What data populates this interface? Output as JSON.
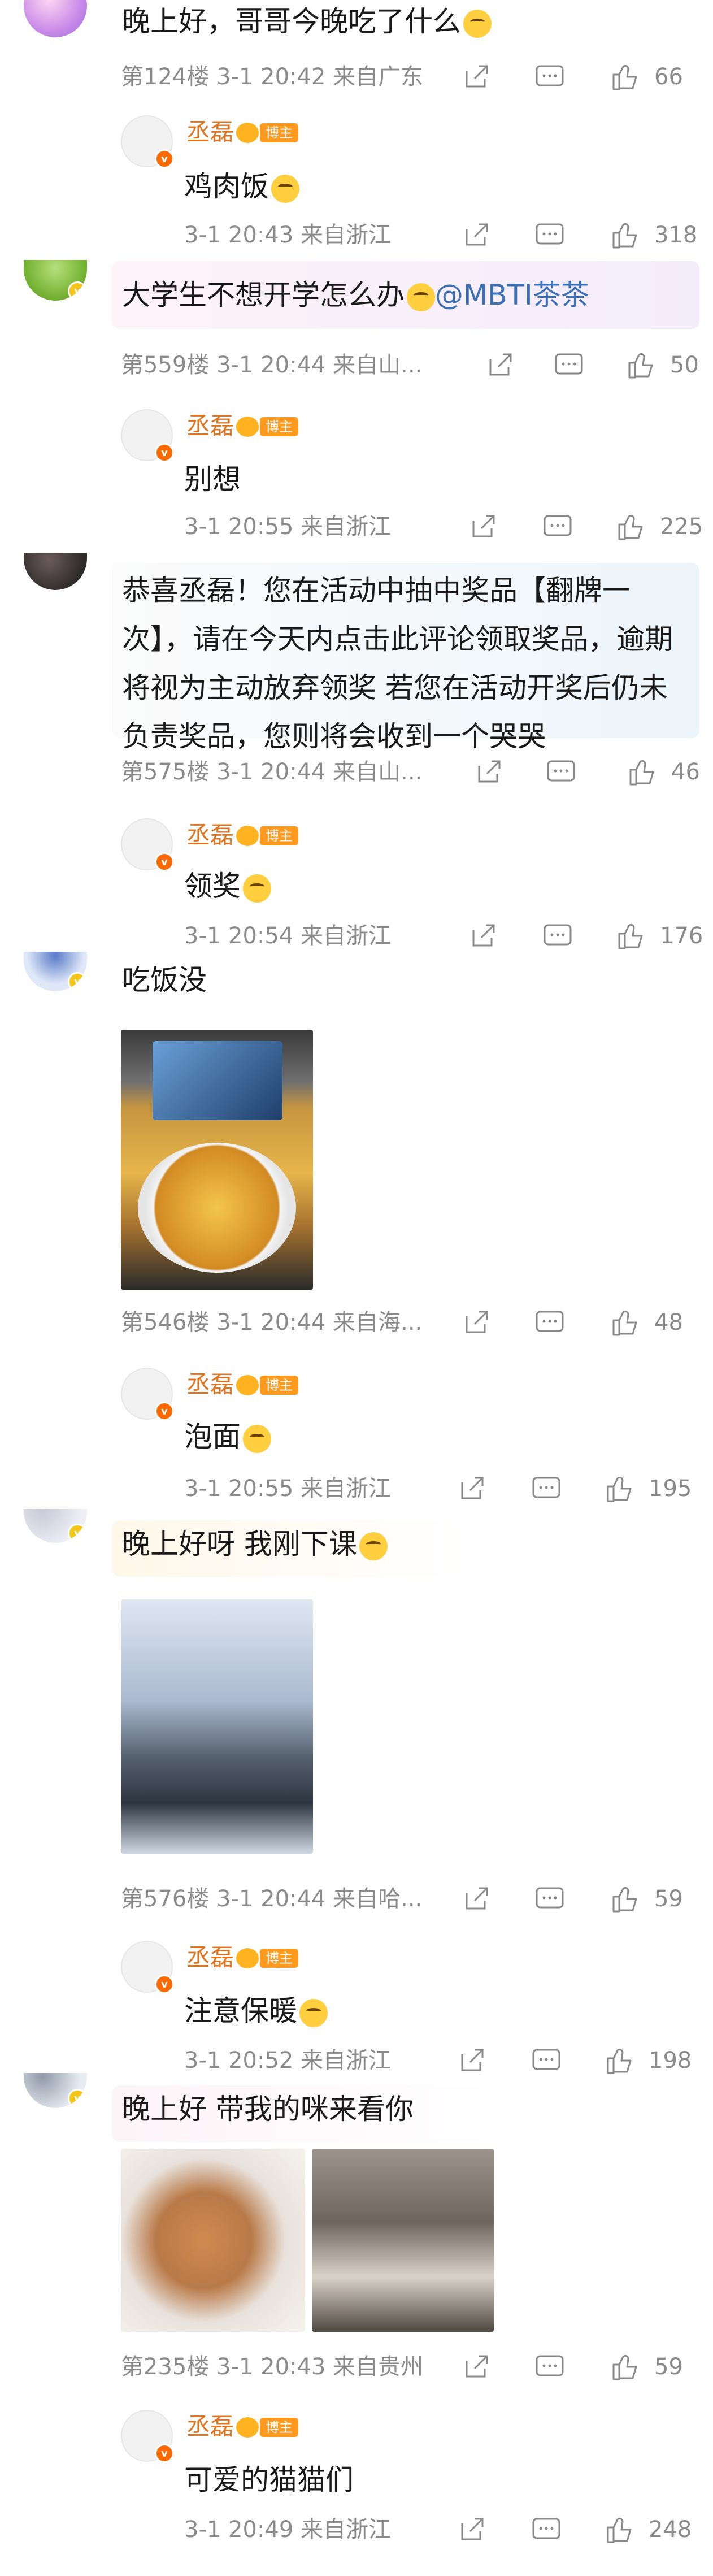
{
  "author": {
    "name": "丞磊",
    "badge": "博主"
  },
  "comments": [
    {
      "text": "晚上好，哥哥今晚吃了什么",
      "floor": "第124楼",
      "time": "3-1 20:42",
      "location": "来自广东",
      "likes": "66",
      "reply": {
        "text": "鸡肉饭",
        "time": "3-1 20:43",
        "location": "来自浙江",
        "likes": "318"
      }
    },
    {
      "text": "大学生不想开学怎么办",
      "mention": "@MBTI茶茶",
      "floor": "第559楼",
      "time": "3-1 20:44",
      "location": "来自山...",
      "likes": "50",
      "reply": {
        "text": "别想",
        "time": "3-1 20:55",
        "location": "来自浙江",
        "likes": "225"
      }
    },
    {
      "text": "恭喜丞磊！您在活动中抽中奖品【翻牌一次】，请在今天内点击此评论领取奖品，逾期将视为主动放弃领奖 若您在活动开奖后仍未负责奖品，您则将会收到一个哭哭",
      "floor": "第575楼",
      "time": "3-1 20:44",
      "location": "来自山...",
      "likes": "46",
      "reply": {
        "text": "领奖",
        "time": "3-1 20:54",
        "location": "来自浙江",
        "likes": "176"
      }
    },
    {
      "text": "吃饭没",
      "floor": "第546楼",
      "time": "3-1 20:44",
      "location": "来自海...",
      "likes": "48",
      "reply": {
        "text": "泡面",
        "time": "3-1 20:55",
        "location": "来自浙江",
        "likes": "195"
      }
    },
    {
      "text": "晚上好呀 我刚下课",
      "floor": "第576楼",
      "time": "3-1 20:44",
      "location": "来自哈...",
      "likes": "59",
      "reply": {
        "text": "注意保暖",
        "time": "3-1 20:52",
        "location": "来自浙江",
        "likes": "198"
      }
    },
    {
      "text": "晚上好 带我的咪来看你",
      "floor": "第235楼",
      "time": "3-1 20:43",
      "location": "来自贵州",
      "likes": "59",
      "reply": {
        "text": "可爱的猫猫们",
        "time": "3-1 20:49",
        "location": "来自浙江",
        "likes": "248"
      }
    }
  ]
}
